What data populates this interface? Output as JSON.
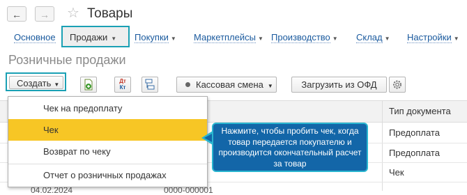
{
  "window": {
    "title": "Товары",
    "back_glyph": "←",
    "forward_glyph": "→",
    "favorite_glyph": "☆"
  },
  "menu": {
    "items": [
      {
        "label": "Основное"
      },
      {
        "label": "Продажи",
        "active": true
      },
      {
        "label": "Покупки"
      },
      {
        "label": "Маркетплейсы"
      },
      {
        "label": "Производство"
      },
      {
        "label": "Склад"
      },
      {
        "label": "Настройки"
      }
    ],
    "arrow_glyph": "▼"
  },
  "page": {
    "subtitle": "Розничные продажи"
  },
  "toolbar": {
    "create_label": "Создать",
    "cash_shift_label": "Кассовая смена",
    "load_ofd_label": "Загрузить из ОФД",
    "dt_kt_top": "Дт",
    "dt_kt_bottom": "Кт"
  },
  "dropdown": {
    "items": [
      {
        "label": "Чек на предоплату"
      },
      {
        "label": "Чек",
        "highlighted": true
      },
      {
        "label": "Возврат по чеку"
      },
      {
        "label": "Отчет о розничных продажах"
      }
    ]
  },
  "table": {
    "doc_type_header": "Тип документа",
    "doc_types": [
      "Предоплата",
      "Предоплата",
      "Чек"
    ],
    "truncated_date": "04.02.2024",
    "truncated_number": "0000-000001"
  },
  "callout": {
    "text": "Нажмите, чтобы пробить чек, когда товар передается покупателю и производится окончательный расчет за товар"
  },
  "colors": {
    "accent_outline": "#1aa0b4",
    "highlight": "#f7c625",
    "callout_bg": "#1366a8",
    "link": "#1a5a9e"
  }
}
